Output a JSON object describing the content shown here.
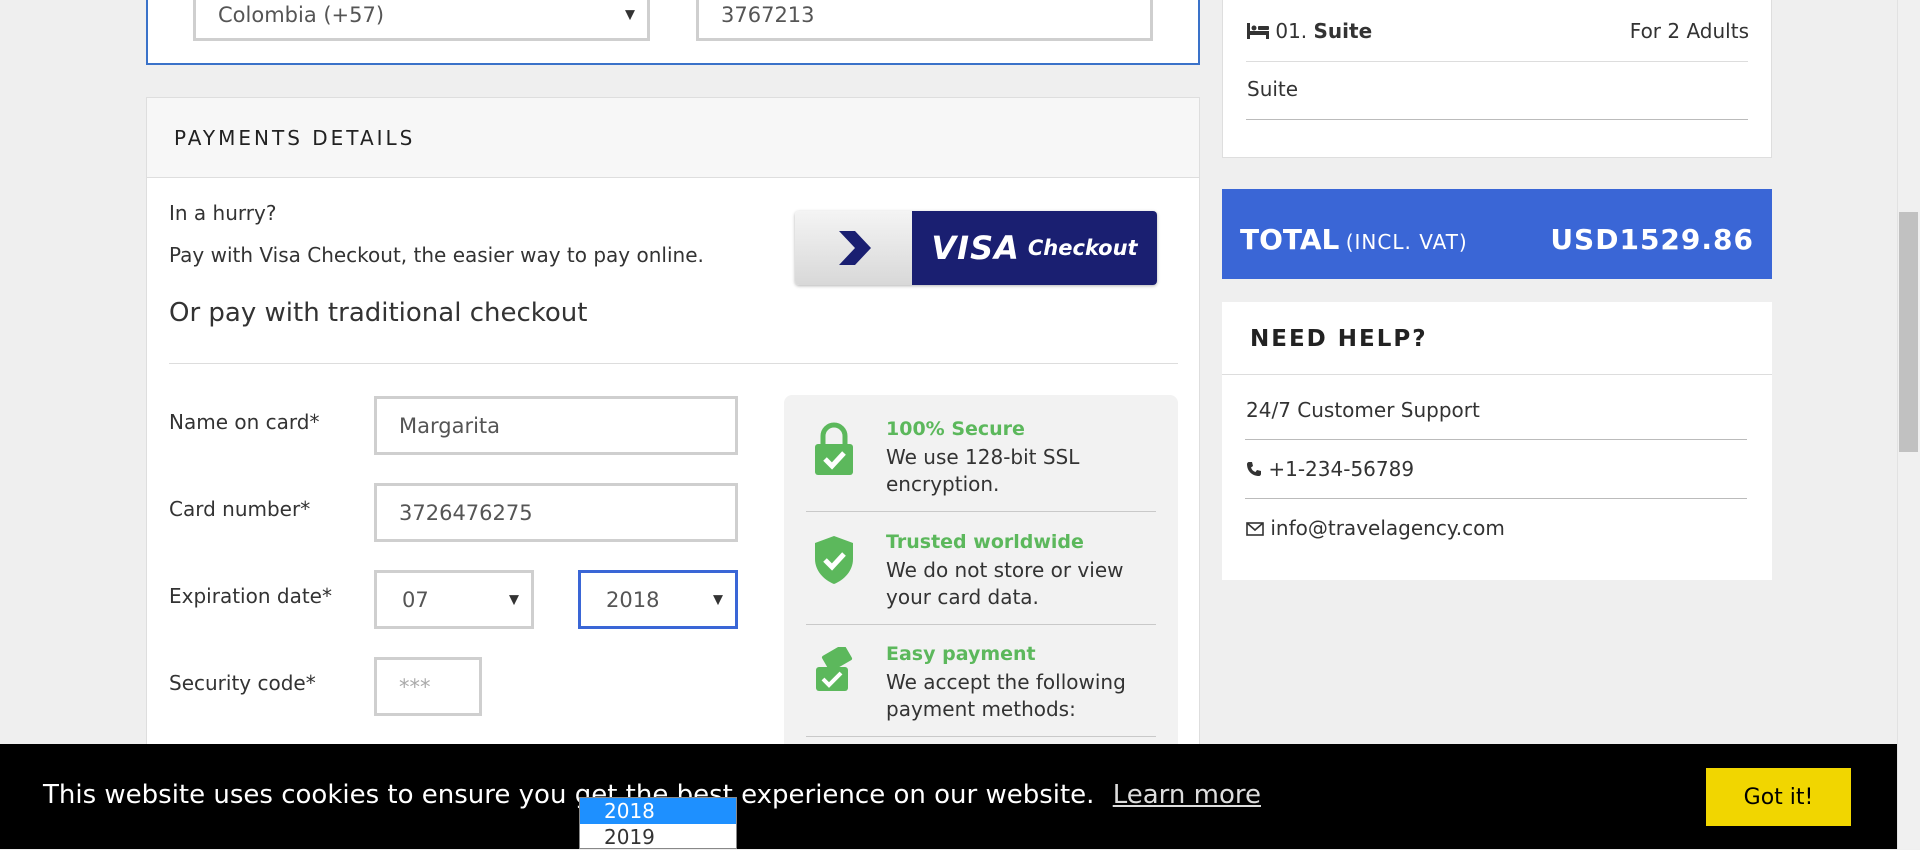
{
  "contact": {
    "country_code_value": "Colombia (+57)",
    "phone_value": "3767213"
  },
  "payment": {
    "title": "PAYMENTS DETAILS",
    "hurry_text": "In a hurry?",
    "visa_text": "Pay with Visa Checkout, the easier way to pay online.",
    "visa_button": {
      "word": "VISA",
      "suffix": "Checkout"
    },
    "traditional_heading": "Or pay with traditional checkout",
    "fields": {
      "name_label": "Name on card*",
      "name_value": "Margarita",
      "card_label": "Card number*",
      "card_value": "3726476275",
      "expiry_label": "Expiration date*",
      "expiry_month": "07",
      "expiry_year": "2018",
      "security_label": "Security code*",
      "security_placeholder": "***"
    },
    "secure_items": [
      {
        "title": "100% Secure",
        "text": "We use 128-bit SSL encryption.",
        "icon": "lock-check-icon"
      },
      {
        "title": "Trusted worldwide",
        "text": "We do not store or view your card data.",
        "icon": "shield-check-icon"
      },
      {
        "title": "Easy payment",
        "text": "We accept the following payment methods:",
        "icon": "cards-check-icon"
      }
    ],
    "accent_green": "#5cb85c"
  },
  "room": {
    "number": "01.",
    "name": "Suite",
    "occupancy": "For 2 Adults",
    "type": "Suite"
  },
  "total": {
    "label": "TOTAL",
    "note": "(INCL. VAT)",
    "amount": "USD1529.86",
    "color": "#3a66d6"
  },
  "help": {
    "title": "NEED HELP?",
    "support": "24/7 Customer Support",
    "phone": "+1-234-56789",
    "email": "info@travelagency.com"
  },
  "cookie": {
    "message": "This website uses cookies to ensure you get the best experience on our website.",
    "learn_more": "Learn more",
    "accept": "Got it!",
    "accept_color": "#f1d600"
  },
  "year_dropdown": {
    "options": [
      "2018",
      "2019"
    ],
    "selected": "2018"
  }
}
